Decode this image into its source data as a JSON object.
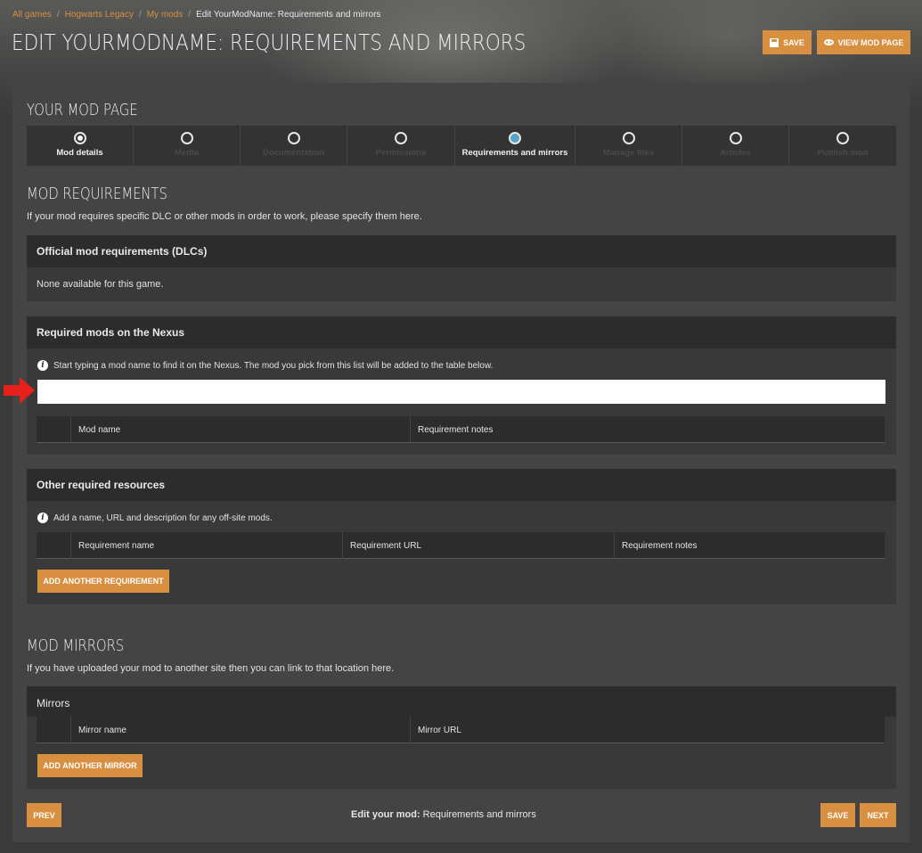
{
  "breadcrumbs": {
    "all_games": "All games",
    "game": "Hogwarts Legacy",
    "my_mods": "My mods",
    "current": "Edit YourModName: Requirements and mirrors",
    "separator": "/"
  },
  "page_title": "EDIT YOURMODNAME: REQUIREMENTS AND MIRRORS",
  "header_actions": {
    "save_label": "SAVE",
    "view_label": "VIEW MOD PAGE"
  },
  "mod_page_heading": "YOUR MOD PAGE",
  "steps": [
    {
      "label": "Mod details",
      "state": "done"
    },
    {
      "label": "Media",
      "state": "disabled"
    },
    {
      "label": "Documentation",
      "state": "disabled"
    },
    {
      "label": "Permissions",
      "state": "disabled"
    },
    {
      "label": "Requirements and mirrors",
      "state": "active"
    },
    {
      "label": "Manage files",
      "state": "disabled"
    },
    {
      "label": "Articles",
      "state": "disabled"
    },
    {
      "label": "Publish mod",
      "state": "disabled"
    }
  ],
  "requirements": {
    "heading": "MOD REQUIREMENTS",
    "description": "If your mod requires specific DLC or other mods in order to work, please specify them here.",
    "official": {
      "title": "Official mod requirements (DLCs)",
      "empty_text": "None available for this game."
    },
    "nexus": {
      "title": "Required mods on the Nexus",
      "info": "Start typing a mod name to find it on the Nexus. The mod you pick from this list will be added to the table below.",
      "search_value": "",
      "columns": [
        "",
        "Mod name",
        "Requirement notes"
      ]
    },
    "other": {
      "title": "Other required resources",
      "info": "Add a name, URL and description for any off-site mods.",
      "columns": [
        "",
        "Requirement name",
        "Requirement URL",
        "Requirement notes"
      ],
      "add_label": "ADD ANOTHER REQUIREMENT"
    }
  },
  "mirrors": {
    "heading": "MOD MIRRORS",
    "description": "If you have uploaded your mod to another site then you can link to that location here.",
    "box_title": "Mirrors",
    "columns": [
      "",
      "Mirror name",
      "Mirror URL"
    ],
    "add_label": "ADD ANOTHER MIRROR"
  },
  "footer": {
    "prev_label": "PREV",
    "status_bold": "Edit your mod:",
    "status_text": " Requirements and mirrors",
    "save_label": "SAVE",
    "next_label": "NEXT"
  },
  "colors": {
    "accent": "#d98f40",
    "active_step": "#57a5cc",
    "arrow": "#e8201c"
  },
  "icons": {
    "save": "floppy-disk-icon",
    "view": "eye-icon",
    "info": "info-icon",
    "pointer": "red-arrow-icon"
  }
}
